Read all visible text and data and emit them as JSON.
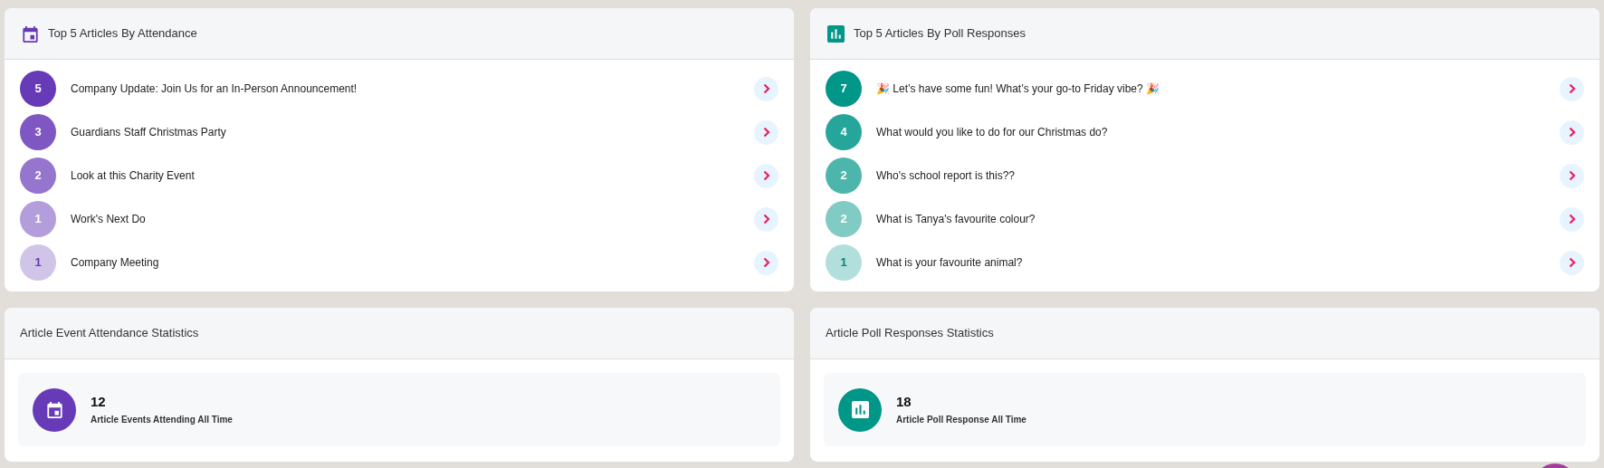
{
  "top_cards": [
    {
      "kind": "attendance",
      "title": "Top 5 Articles By Attendance",
      "items": [
        {
          "count": "5",
          "title": "Company Update: Join Us for an In-Person Announcement!",
          "color": "#673ab7"
        },
        {
          "count": "3",
          "title": "Guardians Staff Christmas Party",
          "color": "#7e57c2"
        },
        {
          "count": "2",
          "title": "Look at this Charity Event",
          "color": "#9575cd"
        },
        {
          "count": "1",
          "title": "Work's Next Do",
          "color": "#b39ddb"
        },
        {
          "count": "1",
          "title": "Company Meeting",
          "color": "#d1c4e9"
        }
      ]
    },
    {
      "kind": "poll",
      "title": "Top 5 Articles By Poll Responses",
      "items": [
        {
          "count": "7",
          "title": "🎉 Let’s have some fun! What’s your go-to Friday vibe? 🎉",
          "color": "#009688"
        },
        {
          "count": "4",
          "title": "What would you like to do for our Christmas do?",
          "color": "#26a69a"
        },
        {
          "count": "2",
          "title": "Who's school report is this??",
          "color": "#4db6ac"
        },
        {
          "count": "2",
          "title": "What is Tanya's favourite colour?",
          "color": "#80cbc4"
        },
        {
          "count": "1",
          "title": "What is your favourite animal?",
          "color": "#b2dfdb"
        }
      ]
    }
  ],
  "stat_cards": [
    {
      "kind": "attendance",
      "title": "Article Event Attendance Statistics",
      "value": "12",
      "label": "Article Events Attending All Time"
    },
    {
      "kind": "poll",
      "title": "Article Poll Responses Statistics",
      "value": "18",
      "label": "Article Poll Response All Time"
    }
  ]
}
